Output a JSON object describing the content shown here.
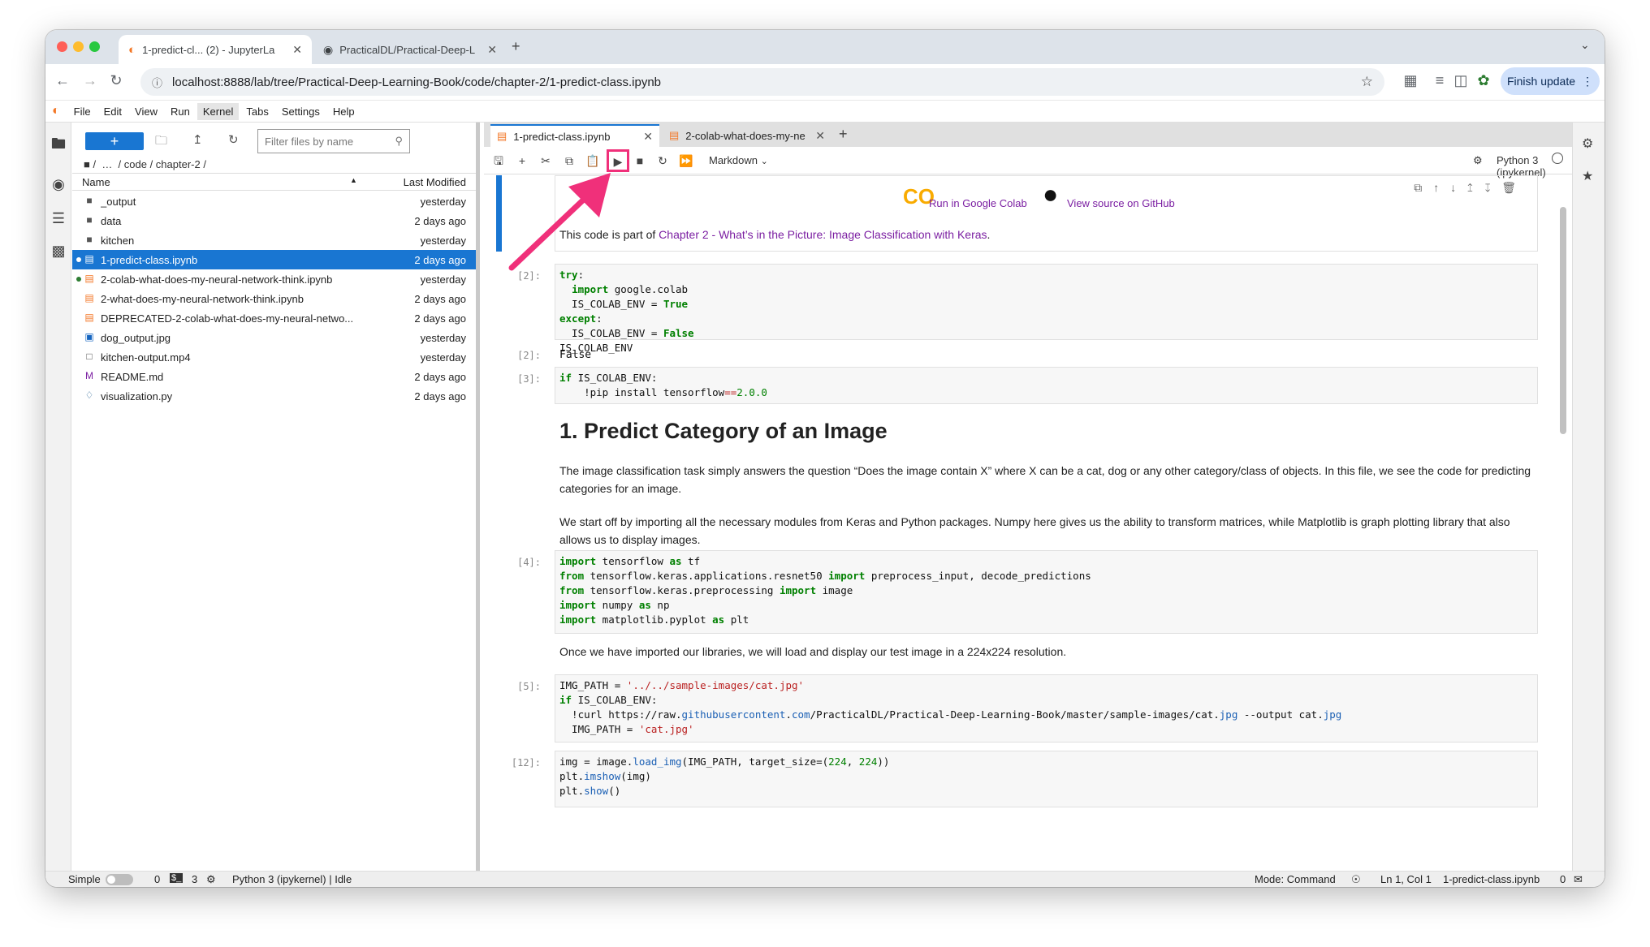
{
  "browser": {
    "tabs": [
      {
        "title": "1-predict-cl... (2) - JupyterLa"
      },
      {
        "title": "PracticalDL/Practical-Deep-L"
      }
    ],
    "url": "localhost:8888/lab/tree/Practical-Deep-Learning-Book/code/chapter-2/1-predict-class.ipynb",
    "finish_update": "Finish update"
  },
  "menu": [
    "File",
    "Edit",
    "View",
    "Run",
    "Kernel",
    "Tabs",
    "Settings",
    "Help"
  ],
  "filebrowser": {
    "filter_placeholder": "Filter files by name",
    "breadcrumb": "/  …  / code / chapter-2 /",
    "col_name": "Name",
    "col_modified": "Last Modified",
    "files": [
      {
        "name": "_output",
        "modified": "yesterday",
        "icon": "folder-icon"
      },
      {
        "name": "data",
        "modified": "2 days ago",
        "icon": "folder-icon"
      },
      {
        "name": "kitchen",
        "modified": "yesterday",
        "icon": "folder-icon"
      },
      {
        "name": "1-predict-class.ipynb",
        "modified": "2 days ago",
        "icon": "notebook-icon"
      },
      {
        "name": "2-colab-what-does-my-neural-network-think.ipynb",
        "modified": "yesterday",
        "icon": "notebook-icon"
      },
      {
        "name": "2-what-does-my-neural-network-think.ipynb",
        "modified": "2 days ago",
        "icon": "notebook-icon"
      },
      {
        "name": "DEPRECATED-2-colab-what-does-my-neural-netwo...",
        "modified": "2 days ago",
        "icon": "notebook-icon"
      },
      {
        "name": "dog_output.jpg",
        "modified": "yesterday",
        "icon": "image-icon"
      },
      {
        "name": "kitchen-output.mp4",
        "modified": "yesterday",
        "icon": "file-icon"
      },
      {
        "name": "README.md",
        "modified": "2 days ago",
        "icon": "markdown-icon"
      },
      {
        "name": "visualization.py",
        "modified": "2 days ago",
        "icon": "python-icon"
      }
    ]
  },
  "notebook": {
    "tabs": [
      {
        "title": "1-predict-class.ipynb"
      },
      {
        "title": "2-colab-what-does-my-ne"
      }
    ],
    "cell_type": "Markdown",
    "kernel": "Python 3 (ipykernel)",
    "colab_link": "Run in Google Colab",
    "github_link": "View source on GitHub",
    "intro_text": "This code is part of ",
    "intro_link": "Chapter 2 - What’s in the Picture: Image Classification with Keras",
    "intro_end": ".",
    "heading": "1. Predict Category of an Image",
    "para1": "The image classification task simply answers the question “Does the image contain X” where X can be a cat, dog or any other category/class of objects. In this file, we see the code for predicting categories for an image.",
    "para2": "We start off by importing all the necessary modules from Keras and Python packages. Numpy here gives us the ability to transform matrices, while Matplotlib is graph plotting library that also allows us to display images.",
    "para3": "Once we have imported our libraries, we will load and display our test image in a 224x224 resolution.",
    "prompts": {
      "p2": "[2]:",
      "o2": "[2]:",
      "p3": "[3]:",
      "p4": "[4]:",
      "p5": "[5]:",
      "p12": "[12]:"
    },
    "output2": "False"
  },
  "status": {
    "mode_label": "Simple",
    "count1": "0",
    "count2": "3",
    "kernel_status": "Python 3 (ipykernel) | Idle",
    "mode": "Mode: Command",
    "position": "Ln 1, Col 1",
    "file": "1-predict-class.ipynb",
    "notif": "0"
  },
  "colors": {
    "accent": "#1976d2",
    "highlight": "#f0307a",
    "link": "#7b1fa2"
  }
}
